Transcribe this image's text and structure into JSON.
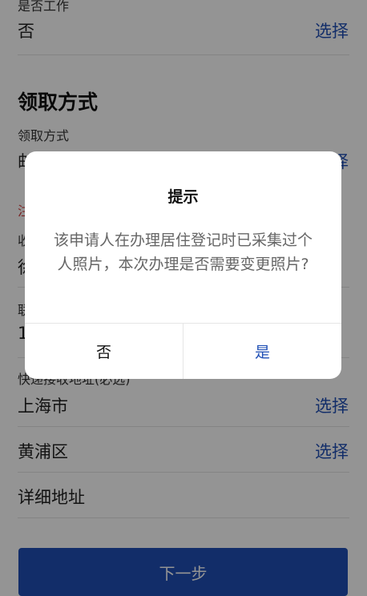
{
  "form": {
    "work_label": "是否工作",
    "work_value": "否",
    "select_label": "选择",
    "section_title": "领取方式",
    "pickup_label": "领取方式",
    "pickup_value": "邮政寄送",
    "note_text": "注",
    "receiver_label": "收",
    "receiver_value": "徐",
    "contact_label": "联",
    "contact_value": "1",
    "address_label": "快递接收地址(必选)",
    "city_value": "上海市",
    "district_value": "黄浦区",
    "detail_address_placeholder": "详细地址",
    "next_button": "下一步"
  },
  "dialog": {
    "title": "提示",
    "message": "该申请人在办理居住登记时已采集过个人照片，本次办理是否需要变更照片?",
    "no_label": "否",
    "yes_label": "是"
  }
}
